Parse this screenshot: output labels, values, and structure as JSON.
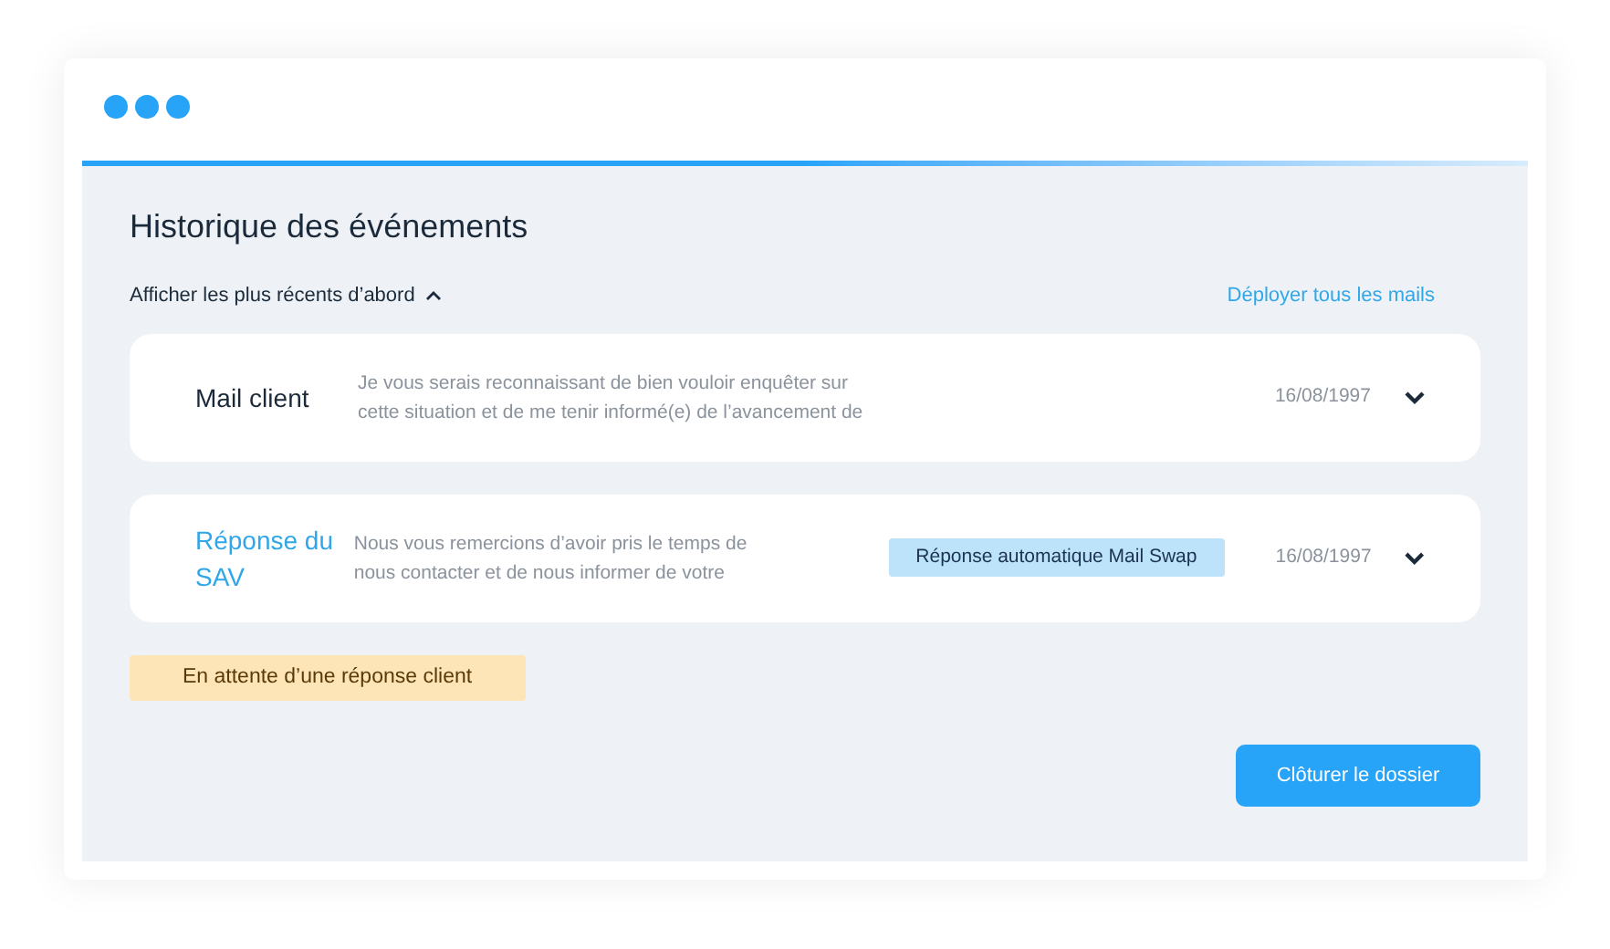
{
  "title": "Historique des événements",
  "sort_label": "Afficher les plus récents d’abord",
  "expand_all_link": "Déployer tous les mails",
  "mails": [
    {
      "kind": "client",
      "sender": "Mail client",
      "excerpt": [
        "Je vous serais reconnaissant de bien vouloir enquêter sur",
        "cette situation et de me tenir informé(e) de l’avancement de"
      ],
      "date": "16/08/1997"
    },
    {
      "kind": "sav",
      "sender": "Réponse du SAV",
      "excerpt": [
        "Nous vous remercions d’avoir pris le temps de",
        "nous contacter et de nous informer de votre"
      ],
      "tag": "Réponse automatique Mail Swap",
      "date": "16/08/1997"
    }
  ],
  "status_badge": "En attente d’une réponse client",
  "close_button": "Clôturer le dossier"
}
